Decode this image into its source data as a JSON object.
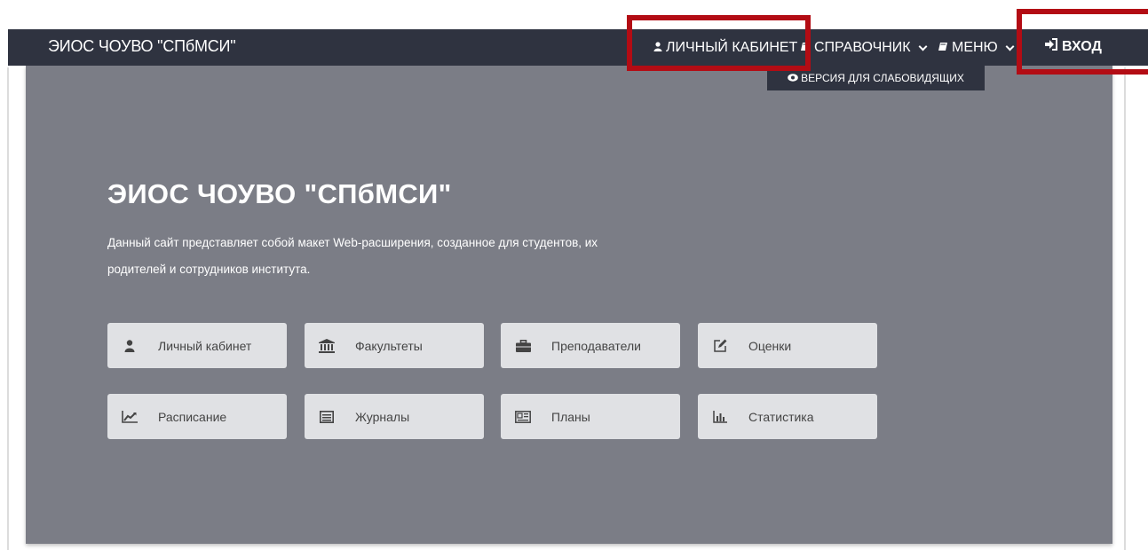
{
  "navbar": {
    "brand": "ЭИОС ЧОУВО \"СПбМСИ\"",
    "personal_cabinet": "ЛИЧНЫЙ КАБИНЕТ",
    "reference": "СПРАВОЧНИК",
    "menu": "МЕНЮ",
    "login": "ВХОД"
  },
  "vision": {
    "label": "ВЕРСИЯ ДЛЯ СЛАБОВИДЯЩИХ"
  },
  "hero": {
    "title": "ЭИОС ЧОУВО \"СПбМСИ\"",
    "description": "Данный сайт представляет собой макет Web-расширения, созданное для студентов, их родителей и сотрудников института."
  },
  "tiles": [
    {
      "label": "Личный кабинет",
      "icon": "user-icon"
    },
    {
      "label": "Факультеты",
      "icon": "institution-icon"
    },
    {
      "label": "Преподаватели",
      "icon": "briefcase-icon"
    },
    {
      "label": "Оценки",
      "icon": "edit-icon"
    },
    {
      "label": "Расписание",
      "icon": "line-chart-icon"
    },
    {
      "label": "Журналы",
      "icon": "list-icon"
    },
    {
      "label": "Планы",
      "icon": "newspaper-icon"
    },
    {
      "label": "Статистика",
      "icon": "bar-chart-icon"
    }
  ],
  "colors": {
    "navbar": "#2f3340",
    "hero": "#7b7d86",
    "tile": "#e0e1e4",
    "highlight": "#b30c14"
  }
}
